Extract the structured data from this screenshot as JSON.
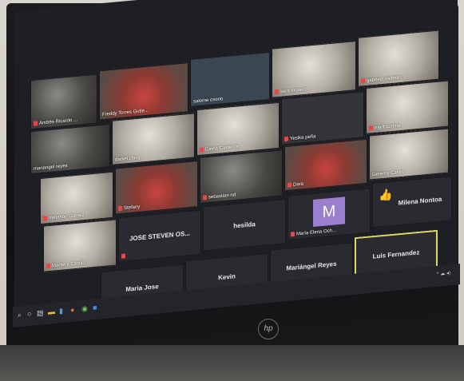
{
  "meeting": {
    "participants": [
      {
        "name": "Andrés Ricardo ...",
        "muted": true
      },
      {
        "name": "Freddy Torres Gutie...",
        "muted": false
      },
      {
        "name": "salome osorio",
        "muted": false
      },
      {
        "name": "sara moreno",
        "muted": true
      },
      {
        "name": "gabriela valentin...",
        "muted": true
      },
      {
        "name": "mariangel reyes",
        "muted": false
      },
      {
        "name": "daniel clavij",
        "muted": false
      },
      {
        "name": "Ginna Calderón",
        "muted": true
      },
      {
        "name": "Yesika peña",
        "muted": true
      },
      {
        "name": "nayit cortina",
        "muted": true
      },
      {
        "name": "Yeferson Gómez",
        "muted": true
      },
      {
        "name": "Stefany",
        "muted": true
      },
      {
        "name": "sebastian nd",
        "muted": true
      },
      {
        "name": "Dara",
        "muted": true
      },
      {
        "name": "Geremy Castro",
        "muted": false
      },
      {
        "name": "Mariana Castillo",
        "muted": true
      },
      {
        "name": "JOSE STEVEN OS...",
        "muted": true
      },
      {
        "name": "hesilda",
        "muted": false
      },
      {
        "name": "María Elena Och...",
        "muted": true
      },
      {
        "name": "Milena Nontoa",
        "muted": false
      },
      {
        "name": "Maria Jose",
        "muted": true
      },
      {
        "name": "Kevin",
        "muted": true
      },
      {
        "name": "Mariángel Reyes",
        "muted": false
      },
      {
        "name": "Luis Fernandez",
        "muted": false
      }
    ],
    "avatar_letter": "M",
    "thumbs_icon": "thumbs-up-icon"
  },
  "taskbar": {
    "tray_text": "^ ☁ ◂)",
    "icons": [
      "search-icon",
      "task-view-icon",
      "file-explorer-icon",
      "edge-icon",
      "store-icon",
      "mail-icon",
      "chrome-icon",
      "zoom-icon"
    ]
  },
  "device": {
    "logo": "hp"
  },
  "colors": {
    "mute": "#e04a4a",
    "active_border": "#d9d96a",
    "avatar_bg": "#9a7fcf",
    "screen_bg": "#1e1f24"
  }
}
